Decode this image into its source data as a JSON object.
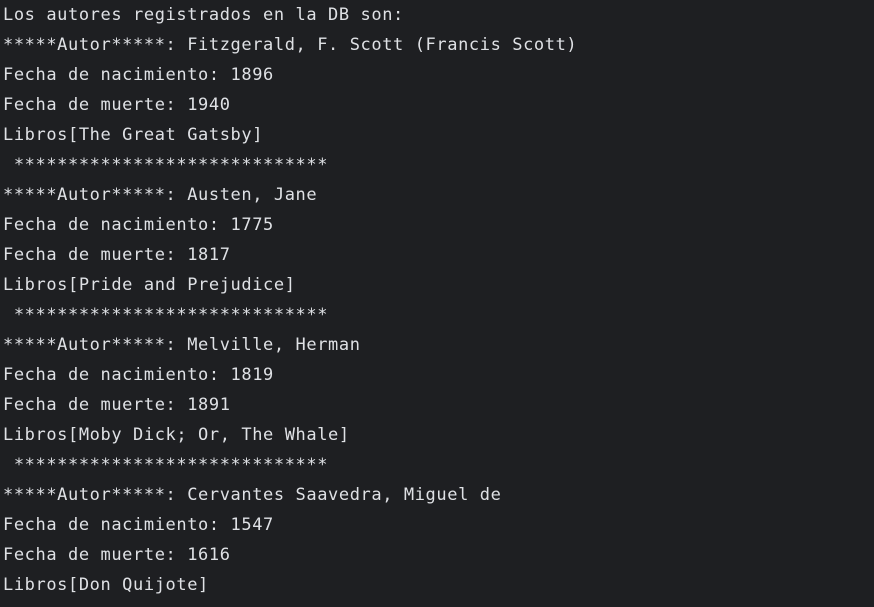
{
  "console": {
    "lines": [
      "Los autores registrados en la DB son:",
      "*****Autor*****: Fitzgerald, F. Scott (Francis Scott)",
      "Fecha de nacimiento: 1896",
      "Fecha de muerte: 1940",
      "Libros[The Great Gatsby]",
      " *****************************",
      "*****Autor*****: Austen, Jane",
      "Fecha de nacimiento: 1775",
      "Fecha de muerte: 1817",
      "Libros[Pride and Prejudice]",
      " *****************************",
      "*****Autor*****: Melville, Herman",
      "Fecha de nacimiento: 1819",
      "Fecha de muerte: 1891",
      "Libros[Moby Dick; Or, The Whale]",
      " *****************************",
      "*****Autor*****: Cervantes Saavedra, Miguel de",
      "Fecha de nacimiento: 1547",
      "Fecha de muerte: 1616",
      "Libros[Don Quijote]"
    ]
  }
}
